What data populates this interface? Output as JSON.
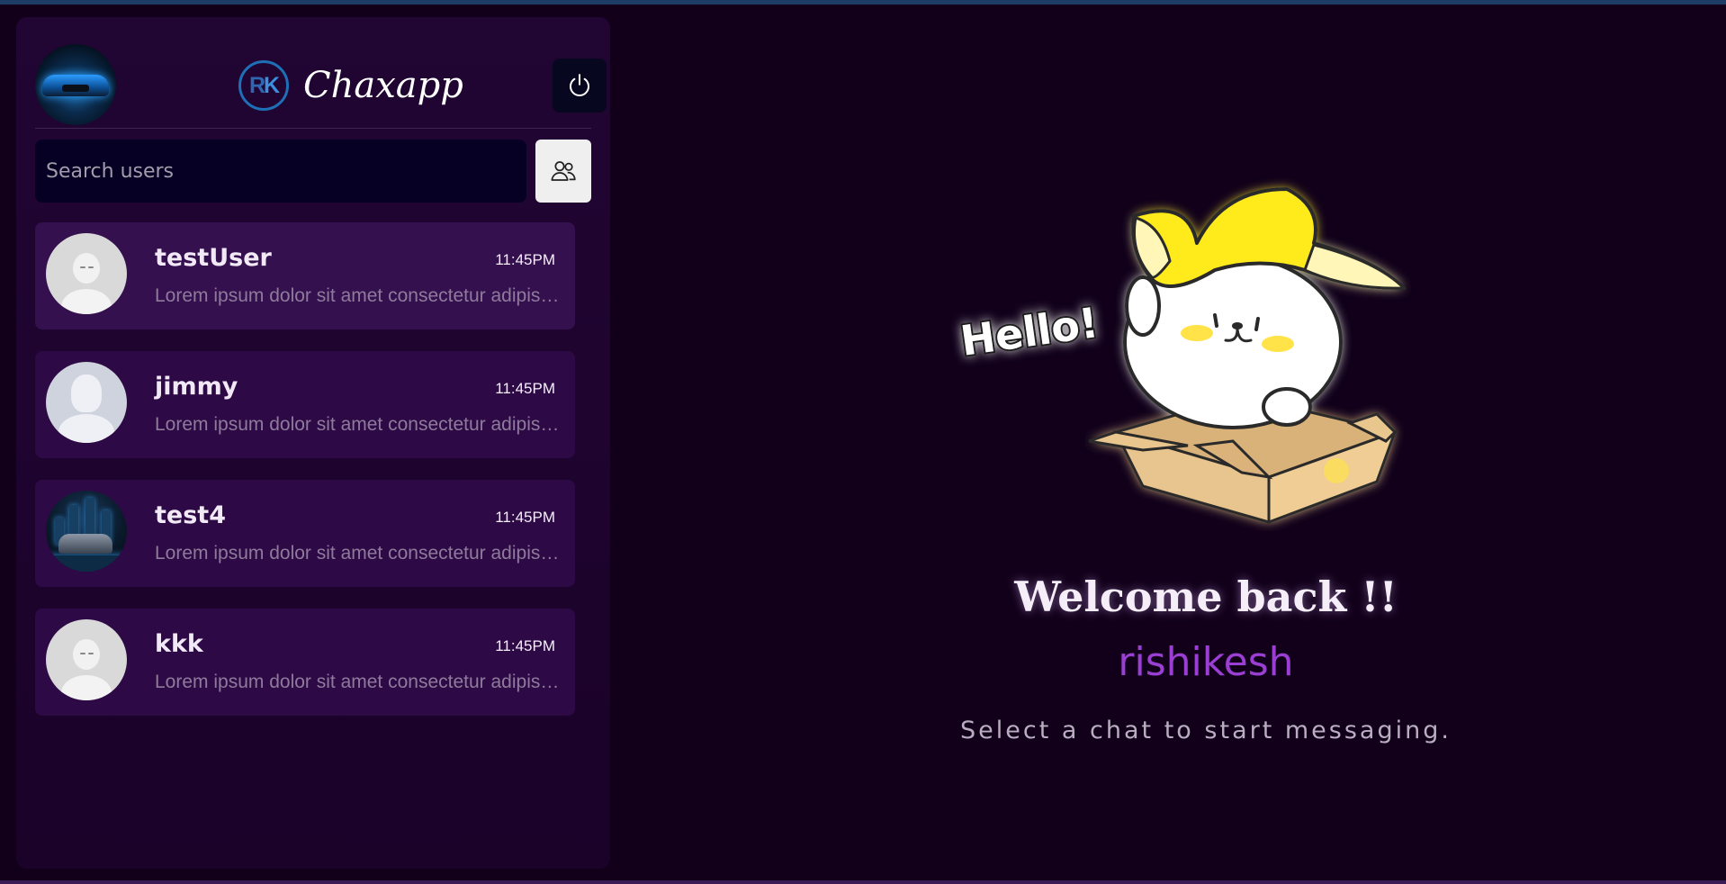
{
  "app": {
    "brand_name": "Chaxapp",
    "logo_text_r": "R",
    "logo_text_k": "K"
  },
  "header": {
    "profile_avatar": "car-photo-avatar",
    "logout_icon": "power-icon"
  },
  "search": {
    "placeholder": "Search users",
    "value": "",
    "group_icon": "users-icon"
  },
  "chats": [
    {
      "name": "testUser",
      "time": "11:45PM",
      "preview": "Lorem ipsum dolor sit amet consectetur adipisicing elit.",
      "avatar": "default-avatar",
      "active": true
    },
    {
      "name": "jimmy",
      "time": "11:45PM",
      "preview": "Lorem ipsum dolor sit amet consectetur adipisicing elit.",
      "avatar": "silhouette-avatar",
      "active": false
    },
    {
      "name": "test4",
      "time": "11:45PM",
      "preview": "Lorem ipsum dolor sit amet consectetur adipisicing elit.",
      "avatar": "city-car-avatar",
      "active": false
    },
    {
      "name": "kkk",
      "time": "11:45PM",
      "preview": "Lorem ipsum dolor sit amet consectetur adipisicing elit.",
      "avatar": "default-avatar",
      "active": false
    }
  ],
  "welcome": {
    "greeting_sign": "Hello!",
    "title": "Welcome back !!",
    "username": "rishikesh",
    "subtitle": "Select a chat to start messaging."
  },
  "colors": {
    "background": "#12001b",
    "sidebar": "#210533",
    "chat_item": "#2d0a45",
    "accent": "#9b3fd4",
    "search_bg": "#050024"
  }
}
